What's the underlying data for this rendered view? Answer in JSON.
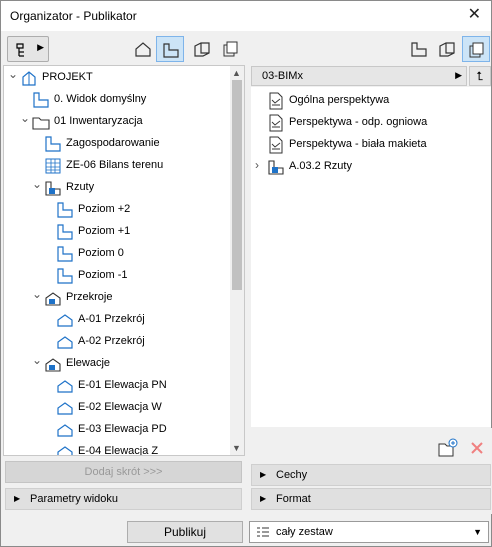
{
  "window": {
    "title": "Organizator - Publikator",
    "close_glyph": "✕"
  },
  "left": {
    "nav_menu_icon": "tree-menu-icon",
    "toolbar_icons": [
      "project-map-icon",
      "view-map-icon",
      "layout-book-icon",
      "publisher-sets-icon"
    ],
    "tree": [
      {
        "label": "PROJEKT",
        "level": 0,
        "expander": "expanded",
        "icon": "project-icon"
      },
      {
        "label": "0. Widok domyślny",
        "level": 1,
        "expander": "none",
        "icon": "view-icon"
      },
      {
        "label": "01 Inwentaryzacja",
        "level": 1,
        "expander": "expanded",
        "icon": "folder-icon"
      },
      {
        "label": "Zagospodarowanie",
        "level": 2,
        "expander": "none",
        "icon": "view-icon"
      },
      {
        "label": "ZE-06 Bilans terenu",
        "level": 2,
        "expander": "none",
        "icon": "schedule-icon"
      },
      {
        "label": "Rzuty",
        "level": 2,
        "expander": "expanded",
        "icon": "folder-view-icon"
      },
      {
        "label": "Poziom +2",
        "level": 3,
        "expander": "none",
        "icon": "view-icon"
      },
      {
        "label": "Poziom +1",
        "level": 3,
        "expander": "none",
        "icon": "view-icon"
      },
      {
        "label": "Poziom 0",
        "level": 3,
        "expander": "none",
        "icon": "view-icon"
      },
      {
        "label": "Poziom -1",
        "level": 3,
        "expander": "none",
        "icon": "view-icon"
      },
      {
        "label": "Przekroje",
        "level": 2,
        "expander": "expanded",
        "icon": "section-folder-icon"
      },
      {
        "label": "A-01 Przekrój",
        "level": 3,
        "expander": "none",
        "icon": "section-icon"
      },
      {
        "label": "A-02 Przekrój",
        "level": 3,
        "expander": "none",
        "icon": "section-icon"
      },
      {
        "label": "Elewacje",
        "level": 2,
        "expander": "expanded",
        "icon": "section-folder-icon"
      },
      {
        "label": "E-01 Elewacja PN",
        "level": 3,
        "expander": "none",
        "icon": "section-icon"
      },
      {
        "label": "E-02 Elewacja W",
        "level": 3,
        "expander": "none",
        "icon": "section-icon"
      },
      {
        "label": "E-03 Elewacja PD",
        "level": 3,
        "expander": "none",
        "icon": "section-icon"
      },
      {
        "label": "E-04 Elewacja Z",
        "level": 3,
        "expander": "none",
        "icon": "section-icon"
      }
    ],
    "shortcut_button": "Dodaj skrót >>>",
    "view_params": "Parametry widoku"
  },
  "right": {
    "toolbar_icons": [
      "view-map-icon",
      "layout-book-icon",
      "publisher-sets-icon"
    ],
    "set_name": "03-BIMx",
    "items": [
      {
        "label": "Ogólna perspektywa",
        "icon": "perspective-doc-icon",
        "expander": "none"
      },
      {
        "label": "Perspektywa - odp. ogniowa",
        "icon": "perspective-doc-icon",
        "expander": "none"
      },
      {
        "label": "Perspektywa - biała makieta",
        "icon": "perspective-doc-icon",
        "expander": "none"
      },
      {
        "label": "A.03.2 Rzuty",
        "icon": "folder-view-icon",
        "expander": "collapsed"
      }
    ],
    "properties": "Cechy",
    "format": "Format"
  },
  "bottom": {
    "publish_button": "Publikuj",
    "scope_value": "cały zestaw"
  },
  "colors": {
    "accent": "#1e72c8",
    "active_bg": "#cce4f7",
    "delete_red": "#f08080"
  }
}
